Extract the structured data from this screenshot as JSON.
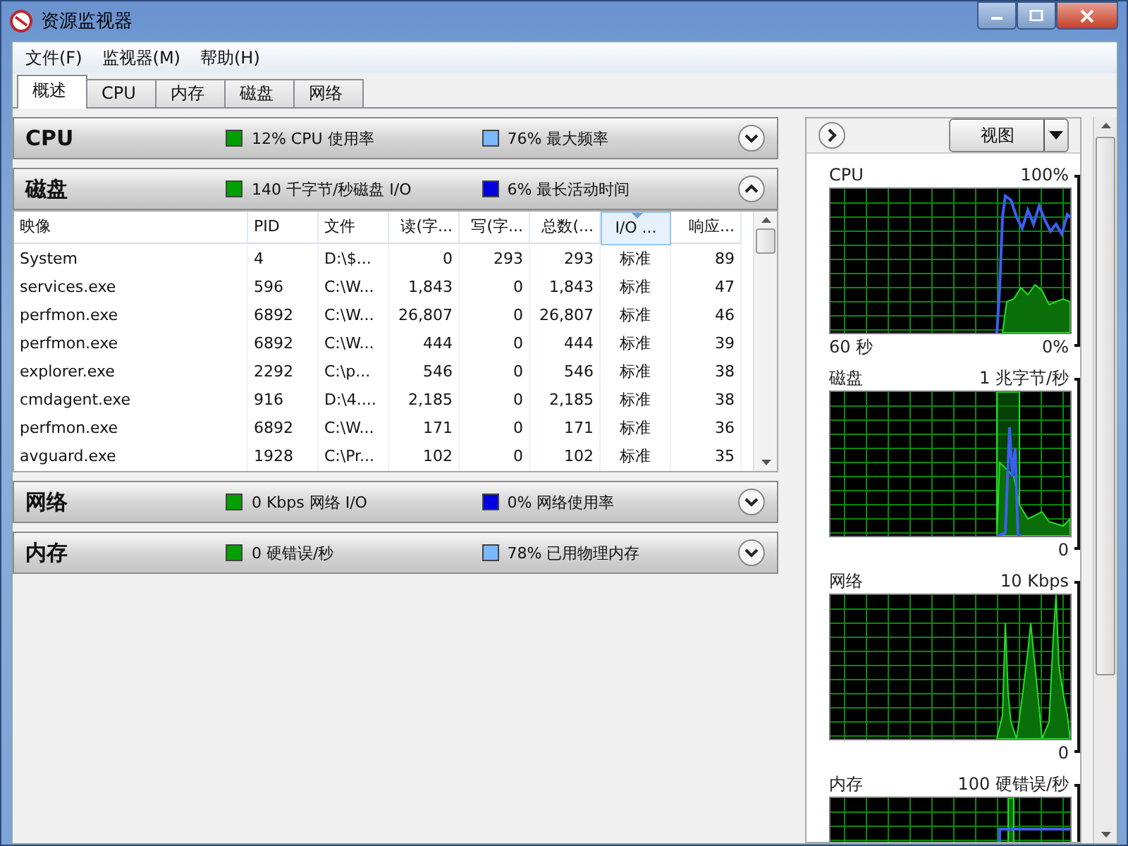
{
  "window": {
    "title": "资源监视器"
  },
  "menu": [
    "文件(F)",
    "监视器(M)",
    "帮助(H)"
  ],
  "tabs": [
    {
      "label": "概述",
      "selected": true
    },
    {
      "label": "CPU",
      "selected": false
    },
    {
      "label": "内存",
      "selected": false
    },
    {
      "label": "磁盘",
      "selected": false
    },
    {
      "label": "网络",
      "selected": false
    }
  ],
  "sections": [
    {
      "title": "CPU",
      "expanded": false,
      "stats": [
        {
          "text": "12% CPU 使用率",
          "color": "#00a000"
        },
        {
          "text": "76% 最大频率",
          "color": "#7ab8ff"
        }
      ]
    },
    {
      "title": "磁盘",
      "expanded": true,
      "stats": [
        {
          "text": "140 千字节/秒磁盘 I/O",
          "color": "#00a000"
        },
        {
          "text": "6% 最长活动时间",
          "color": "#0000e0"
        }
      ],
      "table": {
        "columns": [
          {
            "label": "映像",
            "kind": "text",
            "sorted": false
          },
          {
            "label": "PID",
            "kind": "text",
            "sorted": false
          },
          {
            "label": "文件",
            "kind": "text",
            "sorted": false
          },
          {
            "label": "读(字...",
            "kind": "number",
            "sorted": false
          },
          {
            "label": "写(字...",
            "kind": "number",
            "sorted": false
          },
          {
            "label": "总数(...",
            "kind": "number",
            "sorted": false
          },
          {
            "label": "I/O ...",
            "kind": "center",
            "sorted": true
          },
          {
            "label": "响应...",
            "kind": "number",
            "sorted": false
          }
        ],
        "rows": [
          [
            "System",
            "4",
            "D:\\$...",
            "0",
            "293",
            "293",
            "标准",
            "89"
          ],
          [
            "services.exe",
            "596",
            "C:\\W...",
            "1,843",
            "0",
            "1,843",
            "标准",
            "47"
          ],
          [
            "perfmon.exe",
            "6892",
            "C:\\W...",
            "26,807",
            "0",
            "26,807",
            "标准",
            "46"
          ],
          [
            "perfmon.exe",
            "6892",
            "C:\\W...",
            "444",
            "0",
            "444",
            "标准",
            "39"
          ],
          [
            "explorer.exe",
            "2292",
            "C:\\p...",
            "546",
            "0",
            "546",
            "标准",
            "38"
          ],
          [
            "cmdagent.exe",
            "916",
            "D:\\4....",
            "2,185",
            "0",
            "2,185",
            "标准",
            "38"
          ],
          [
            "perfmon.exe",
            "6892",
            "C:\\W...",
            "171",
            "0",
            "171",
            "标准",
            "36"
          ],
          [
            "avguard.exe",
            "1928",
            "C:\\Pr...",
            "102",
            "0",
            "102",
            "标准",
            "35"
          ]
        ]
      }
    },
    {
      "title": "网络",
      "expanded": false,
      "stats": [
        {
          "text": "0 Kbps 网络 I/O",
          "color": "#00a000"
        },
        {
          "text": "0% 网络使用率",
          "color": "#0000e0"
        }
      ]
    },
    {
      "title": "内存",
      "expanded": false,
      "stats": [
        {
          "text": "0 硬错误/秒",
          "color": "#00a000"
        },
        {
          "text": "78% 已用物理内存",
          "color": "#7ab8ff"
        }
      ]
    }
  ],
  "side_panel": {
    "view_button": "视图",
    "graphs": [
      {
        "title": "CPU",
        "max": "100%",
        "time": "60 秒",
        "min": "0%"
      },
      {
        "title": "磁盘",
        "max": "1 兆字节/秒",
        "min": "0"
      },
      {
        "title": "网络",
        "max": "10 Kbps",
        "min": "0"
      },
      {
        "title": "内存",
        "max": "100 硬错误/秒"
      }
    ]
  }
}
